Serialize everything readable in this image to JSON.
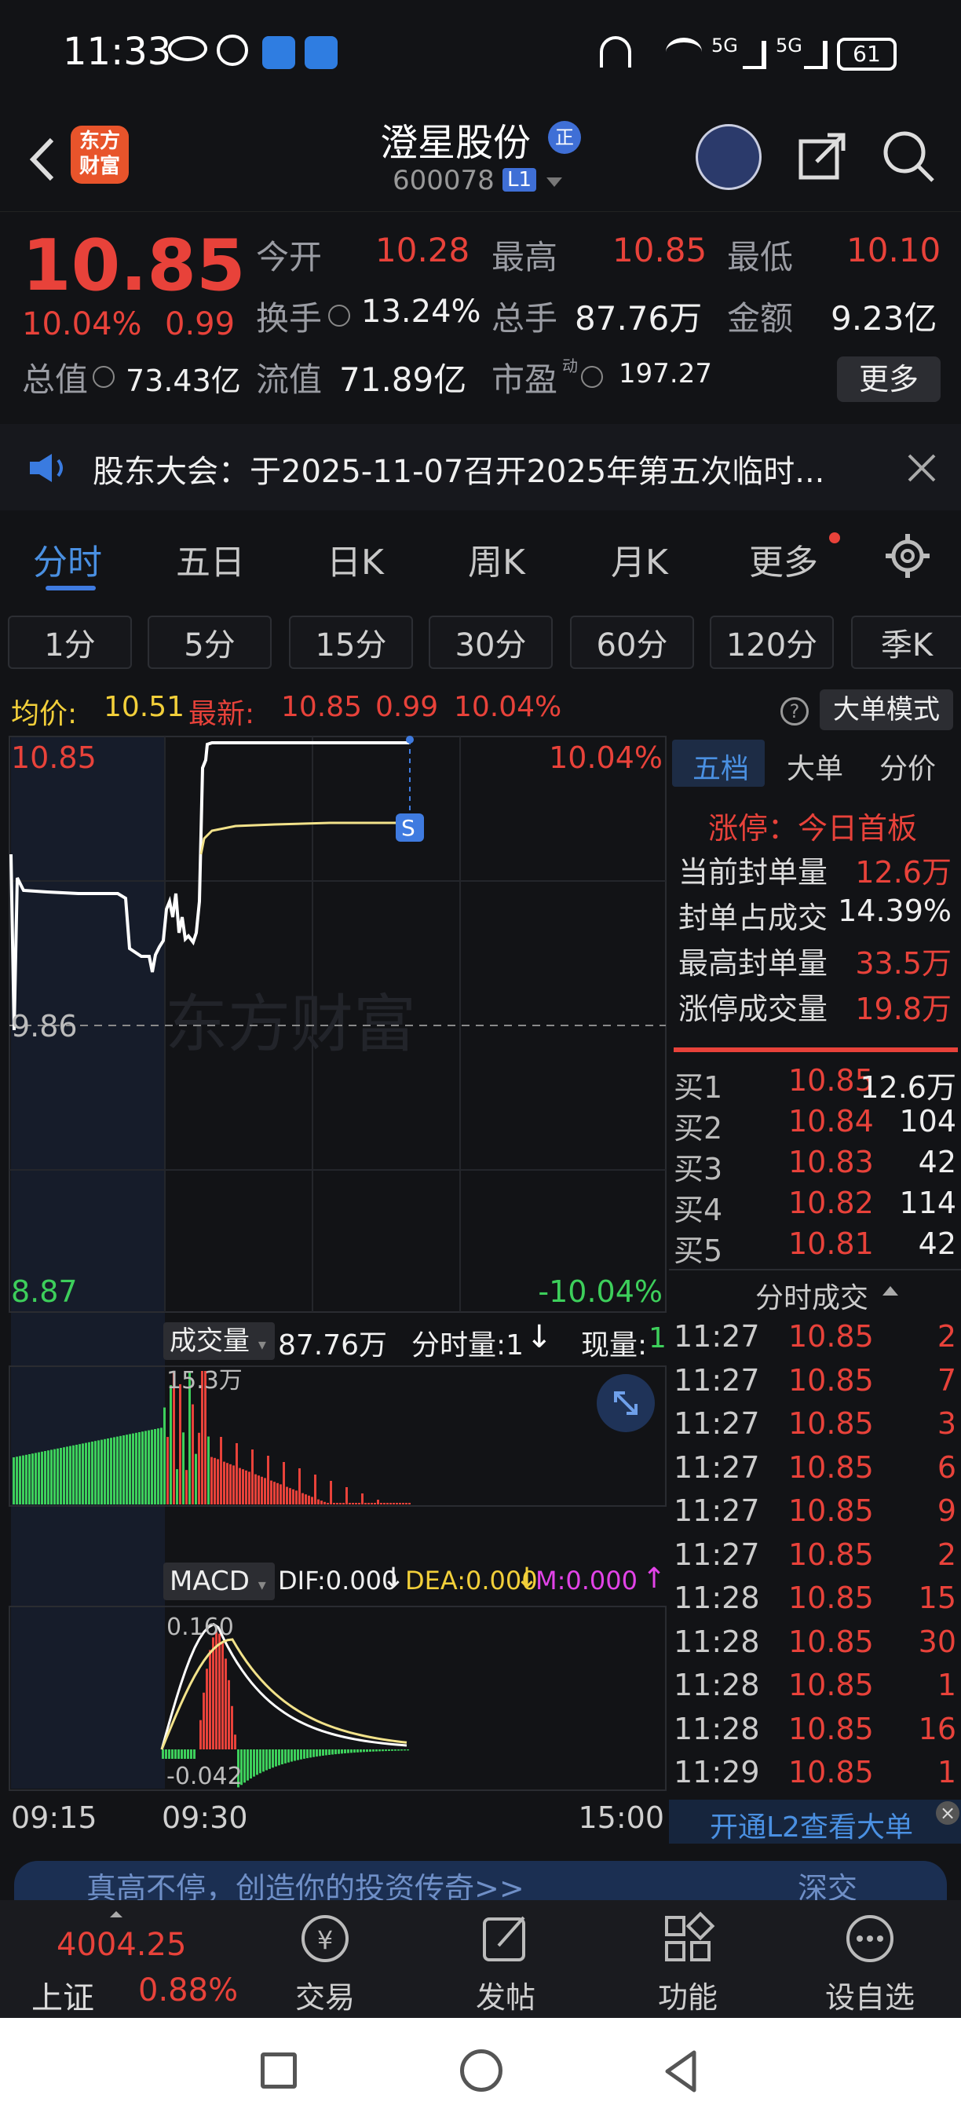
{
  "status_bar": {
    "time": "11:33",
    "battery": "61",
    "net1": "5G",
    "net2": "5G"
  },
  "header": {
    "logo_line1": "东方",
    "logo_line2": "财富",
    "stock_name": "澄星股份",
    "badge": "正",
    "code": "600078",
    "level": "L1"
  },
  "quote": {
    "price": "10.85",
    "pct": "10.04%",
    "change": "0.99",
    "open_label": "今开",
    "open": "10.28",
    "high_label": "最高",
    "high": "10.85",
    "low_label": "最低",
    "low": "10.10",
    "turnover_label": "换手",
    "turnover": "13.24%",
    "volume_label": "总手",
    "volume": "87.76万",
    "amount_label": "金额",
    "amount": "9.23亿",
    "mktcap_label": "总值",
    "mktcap": "73.43亿",
    "float_label": "流值",
    "float": "71.89亿",
    "pe_label": "市盈",
    "pe_sup": "动",
    "pe": "197.27",
    "more_button": "更多"
  },
  "notice": {
    "text": "股东大会：于2025-11-07召开2025年第五次临时..."
  },
  "tabs": [
    {
      "label": "分时"
    },
    {
      "label": "五日"
    },
    {
      "label": "日K"
    },
    {
      "label": "周K"
    },
    {
      "label": "月K"
    },
    {
      "label": "更多"
    }
  ],
  "subtabs": [
    {
      "label": "1分"
    },
    {
      "label": "5分"
    },
    {
      "label": "15分"
    },
    {
      "label": "30分"
    },
    {
      "label": "60分"
    },
    {
      "label": "120分"
    },
    {
      "label": "季K"
    }
  ],
  "infoline": {
    "avg_label": "均价:",
    "avg": "10.51",
    "latest_label": "最新:",
    "latest": "10.85",
    "chg": "0.99",
    "pct": "10.04%",
    "mode_button": "大单模式"
  },
  "chart": {
    "y_top": "10.85",
    "y_mid": "9.86",
    "y_bot": "8.87",
    "pct_top": "10.04%",
    "pct_bot": "-10.04%",
    "marker": "S",
    "watermark": "东方财富",
    "vol_label": "成交量",
    "vol_total": "87.76万",
    "vol_period_label": "分时量:1",
    "vol_now_label": "现量:",
    "vol_now": "1",
    "vol_max": "15.3万",
    "macd_label": "MACD",
    "dif": "DIF:0.000",
    "dea": "DEA:0.000",
    "m": "M:0.000",
    "macd_top": "0.160",
    "macd_bot": "-0.042",
    "time_start": "09:15",
    "time_open": "09:30",
    "time_end": "15:00",
    "colors": {
      "price_line": "#ffffff",
      "avg_line": "#f2e28a",
      "up": "#e8423a",
      "down": "#3dcf5b"
    }
  },
  "right_panel": {
    "tabs": [
      {
        "label": "五档"
      },
      {
        "label": "大单"
      },
      {
        "label": "分价"
      }
    ],
    "limit_title": "涨停：今日首板",
    "limit_rows": [
      {
        "label": "当前封单量",
        "value": "12.6万"
      },
      {
        "label": "封单占成交",
        "value": "14.39%"
      },
      {
        "label": "最高封单量",
        "value": "33.5万"
      },
      {
        "label": "涨停成交量",
        "value": "19.8万"
      }
    ],
    "bids": [
      {
        "label": "买1",
        "price": "10.85",
        "vol": "12.6万"
      },
      {
        "label": "买2",
        "price": "10.84",
        "vol": "104"
      },
      {
        "label": "买3",
        "price": "10.83",
        "vol": "42"
      },
      {
        "label": "买4",
        "price": "10.82",
        "vol": "114"
      },
      {
        "label": "买5",
        "price": "10.81",
        "vol": "42"
      }
    ],
    "ticks_title": "分时成交",
    "ticks": [
      {
        "time": "11:27",
        "price": "10.85",
        "vol": "2",
        "dir": "up"
      },
      {
        "time": "11:27",
        "price": "10.85",
        "vol": "7",
        "dir": "up"
      },
      {
        "time": "11:27",
        "price": "10.85",
        "vol": "3",
        "dir": "up"
      },
      {
        "time": "11:27",
        "price": "10.85",
        "vol": "6",
        "dir": "up"
      },
      {
        "time": "11:27",
        "price": "10.85",
        "vol": "9",
        "dir": "up"
      },
      {
        "time": "11:27",
        "price": "10.85",
        "vol": "2",
        "dir": "up"
      },
      {
        "time": "11:28",
        "price": "10.85",
        "vol": "15",
        "dir": "up"
      },
      {
        "time": "11:28",
        "price": "10.85",
        "vol": "30",
        "dir": "up"
      },
      {
        "time": "11:28",
        "price": "10.85",
        "vol": "1",
        "dir": "up"
      },
      {
        "time": "11:28",
        "price": "10.85",
        "vol": "16",
        "dir": "up"
      },
      {
        "time": "11:29",
        "price": "10.85",
        "vol": "1",
        "dir": "up"
      }
    ],
    "l2_link": "开通L2查看大单"
  },
  "ad_bar": {
    "text": "真高不停，创造你的投资传奇>>",
    "right": "深交"
  },
  "bottom_nav": {
    "index_value": "4004.25",
    "index_name": "上证",
    "index_pct": "0.88%",
    "items": [
      {
        "label": "交易"
      },
      {
        "label": "发帖"
      },
      {
        "label": "功能"
      },
      {
        "label": "设自选"
      }
    ]
  }
}
